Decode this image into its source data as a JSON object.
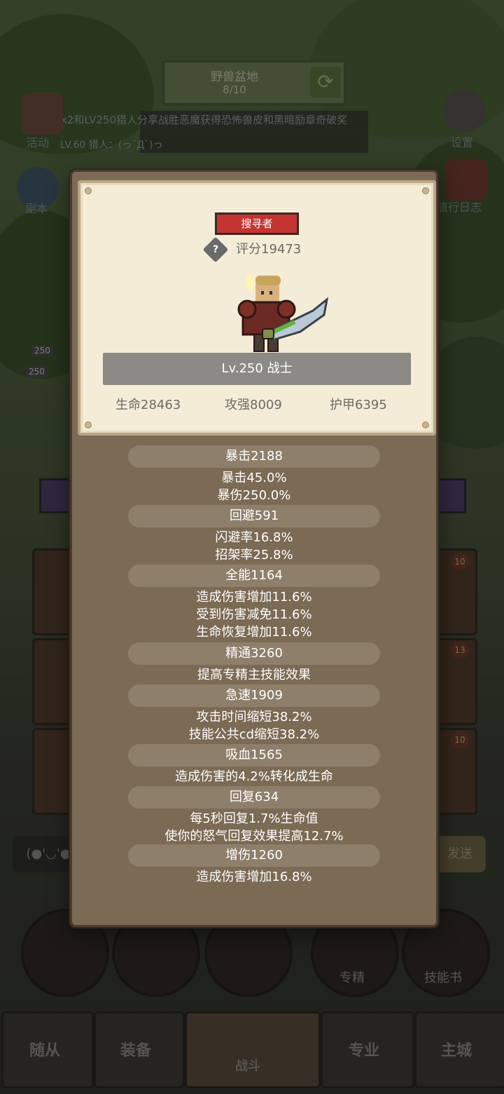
{
  "background": {
    "top_bar": {
      "title": "野兽盆地",
      "count": "8/10"
    },
    "marquee": "LVx2和LV250猎人分享战胜恶魔获得恐怖兽皮和黑暗励章奇破奖",
    "hunter_line": "LV.60 猎人：(っ´Д`)っ",
    "left_labels": [
      "活动",
      "副本"
    ],
    "right_labels": [
      "设置",
      "旅行日志"
    ],
    "slot_badges": [
      "10",
      "13",
      "10"
    ],
    "chat_emote": "(●'◡'●)",
    "send_label": "发送",
    "skill_circles": [
      {
        "label": ""
      },
      {
        "label": ""
      },
      {
        "label": ""
      },
      {
        "label": "专精"
      },
      {
        "label": "技能书"
      }
    ],
    "nav_tabs": [
      "随从",
      "装备",
      "战斗",
      "专业",
      "主城"
    ],
    "level_tags": [
      "250",
      "250"
    ]
  },
  "popup": {
    "role_tag": "搜寻者",
    "help_icon": "?",
    "score": "评分19473",
    "level_class": "Lv.250 战士",
    "base_stats": [
      {
        "label": "生命28463"
      },
      {
        "label": "攻强8009"
      },
      {
        "label": "护甲6395"
      }
    ],
    "sections": [
      {
        "title": "暴击2188",
        "lines": [
          "暴击45.0%",
          "暴伤250.0%"
        ]
      },
      {
        "title": "回避591",
        "lines": [
          "闪避率16.8%",
          "招架率25.8%"
        ]
      },
      {
        "title": "全能1164",
        "lines": [
          "造成伤害增加11.6%",
          "受到伤害减免11.6%",
          "生命恢复增加11.6%"
        ]
      },
      {
        "title": "精通3260",
        "lines": [
          "提高专精主技能效果"
        ]
      },
      {
        "title": "急速1909",
        "lines": [
          "攻击时间缩短38.2%",
          "技能公共cd缩短38.2%"
        ]
      },
      {
        "title": "吸血1565",
        "lines": [
          "造成伤害的4.2%转化成生命"
        ]
      },
      {
        "title": "回复634",
        "lines": [
          "每5秒回复1.7%生命值",
          "使你的怒气回复效果提高12.7%"
        ]
      },
      {
        "title": "增伤1260",
        "lines": [
          "造成伤害增加16.8%"
        ]
      }
    ]
  },
  "colors": {
    "tag_red": "#c33432",
    "card": "#f4ecd7",
    "panel": "#7b6a54"
  }
}
